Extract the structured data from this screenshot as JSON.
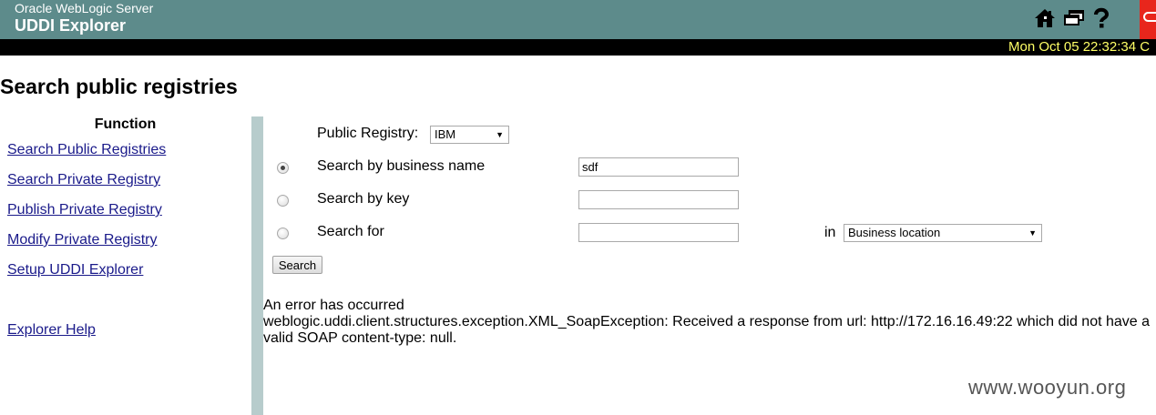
{
  "header": {
    "product_name": "Oracle WebLogic Server",
    "app_title": "UDDI Explorer",
    "icons": [
      "home-icon",
      "windows-icon",
      "help-icon"
    ],
    "datetime": "Mon Oct 05 22:32:34 C",
    "colors": {
      "header_bg": "#5d8b8b",
      "datebar_bg": "#000000",
      "datetime_text": "#ffff66",
      "logo_red": "#e8261c"
    }
  },
  "page": {
    "title": "Search public registries"
  },
  "sidebar": {
    "heading": "Function",
    "links": [
      {
        "label": "Search Public Registries"
      },
      {
        "label": "Search Private Registry"
      },
      {
        "label": "Publish Private Registry"
      },
      {
        "label": "Modify Private Registry"
      },
      {
        "label": "Setup UDDI Explorer"
      },
      {
        "label": "Explorer Help"
      }
    ]
  },
  "form": {
    "registry_label": "Public Registry:",
    "registry_selected": "IBM",
    "options": [
      {
        "label": "Search by business name",
        "value": "sdf",
        "checked": true
      },
      {
        "label": "Search by key",
        "value": "",
        "checked": false
      },
      {
        "label": "Search for",
        "value": "",
        "checked": false
      }
    ],
    "in_label": "in",
    "in_selected": "Business location",
    "search_button": "Search"
  },
  "error": {
    "title": "An error has occurred",
    "message": "weblogic.uddi.client.structures.exception.XML_SoapException: Received a response from url: http://172.16.16.49:22 which did not have a valid SOAP content-type: null."
  },
  "watermark": "www.wooyun.org"
}
